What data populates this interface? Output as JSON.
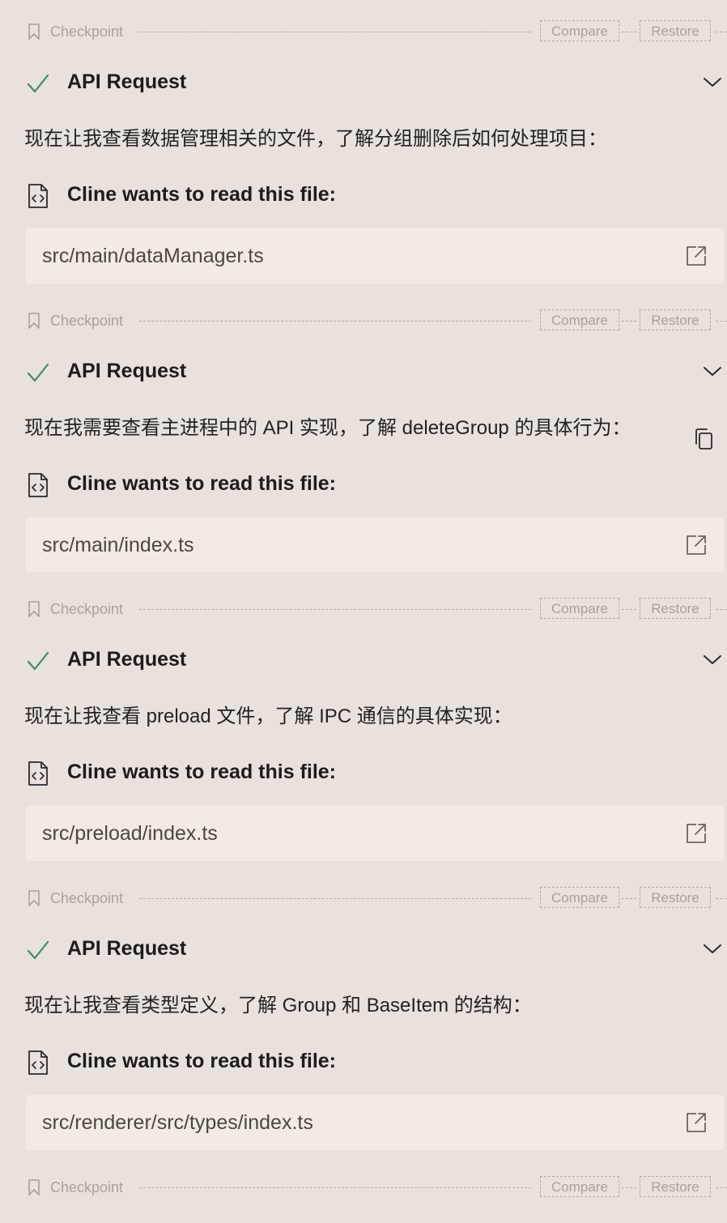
{
  "labels": {
    "checkpoint": "Checkpoint",
    "compare": "Compare",
    "restore": "Restore",
    "api_request": "API Request",
    "read_file": "Cline wants to read this file:"
  },
  "colors": {
    "background": "#e8e1dc",
    "path_box": "#f2ebe5",
    "success_check": "#3f8a6a",
    "muted": "#a8a29e"
  },
  "icons": {
    "checkpoint": "bookmark-icon",
    "api_status": "check-icon",
    "expand": "chevron-down-icon",
    "file": "file-code-icon",
    "open": "external-link-icon",
    "copy": "copy-icon"
  },
  "entries": [
    {
      "message": "现在让我查看数据管理相关的文件，了解分组删除后如何处理项目：",
      "path": "src/main/dataManager.ts"
    },
    {
      "message": "现在我需要查看主进程中的 API 实现，了解 deleteGroup 的具体行为：",
      "path": "src/main/index.ts"
    },
    {
      "message": "现在让我查看 preload 文件，了解 IPC 通信的具体实现：",
      "path": "src/preload/index.ts"
    },
    {
      "message": "现在让我查看类型定义，了解 Group 和 BaseItem 的结构：",
      "path": "src/renderer/src/types/index.ts"
    }
  ]
}
